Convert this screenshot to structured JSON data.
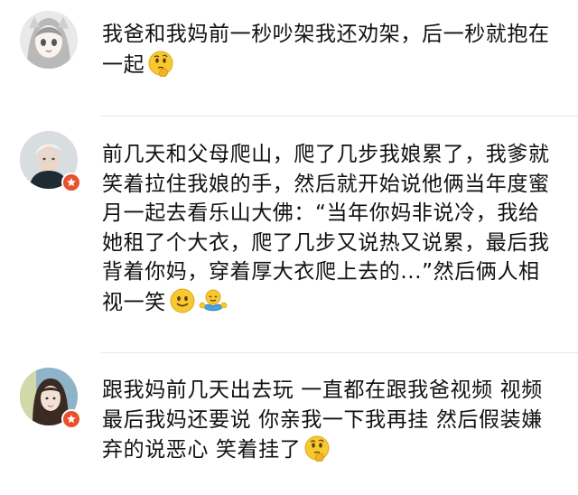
{
  "comments": [
    {
      "text": "我爸和我妈前一秒吵架我还劝架，后一秒就抱在一起",
      "emojis": [
        "thinking-face-emoji"
      ],
      "verified": false
    },
    {
      "text": "前几天和父母爬山，爬了几步我娘累了，我爹就笑着拉住我娘的手，然后就开始说他俩当年度蜜月一起去看乐山大佛：“当年你妈非说冷，我给她租了个大衣，爬了几步又说热又说累，最后我背着你妈，穿着厚大衣爬上去的...”然后俩人相视一笑",
      "emojis": [
        "smile-face-emoji",
        "hug-emoji"
      ],
      "verified": true
    },
    {
      "text": "跟我妈前几天出去玩 一直都在跟我爸视频 视频最后我妈还要说 你亲我一下我再挂 然后假装嫌弃的说恶心 笑着挂了",
      "emojis": [
        "thinking-face-emoji"
      ],
      "verified": true
    }
  ],
  "colors": {
    "badge": "#e8502e",
    "emoji_face": "#f7c82f",
    "divider": "#e6e6e6"
  }
}
